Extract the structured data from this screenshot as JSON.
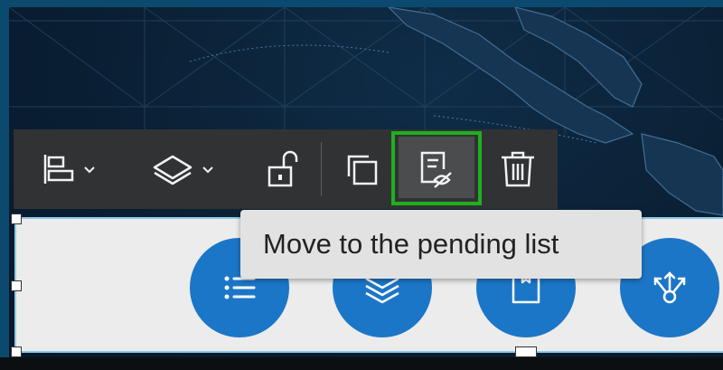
{
  "tooltip": {
    "text": "Move to the pending list"
  },
  "toolbar": {
    "buttons": [
      {
        "name": "align",
        "icon": "align-left-icon",
        "has_dropdown": true
      },
      {
        "name": "layers",
        "icon": "layers-icon",
        "has_dropdown": true
      },
      {
        "name": "lock",
        "icon": "unlock-icon",
        "has_dropdown": false
      },
      {
        "name": "duplicate",
        "icon": "duplicate-icon",
        "has_dropdown": false
      },
      {
        "name": "move-to-pending",
        "icon": "pending-list-icon",
        "has_dropdown": false,
        "highlighted": true
      },
      {
        "name": "delete",
        "icon": "trash-icon",
        "has_dropdown": false
      }
    ]
  },
  "widget": {
    "buttons": [
      {
        "icon": "list-icon"
      },
      {
        "icon": "layers-stack-icon"
      },
      {
        "icon": "bookmark-icon"
      },
      {
        "icon": "share-node-icon"
      }
    ]
  },
  "colors": {
    "toolbar": "#303234",
    "highlight": "#1fb01f",
    "circle_button": "#1c76c7",
    "tooltip_bg": "#e2e2e2",
    "widget_bg": "#ececec"
  }
}
